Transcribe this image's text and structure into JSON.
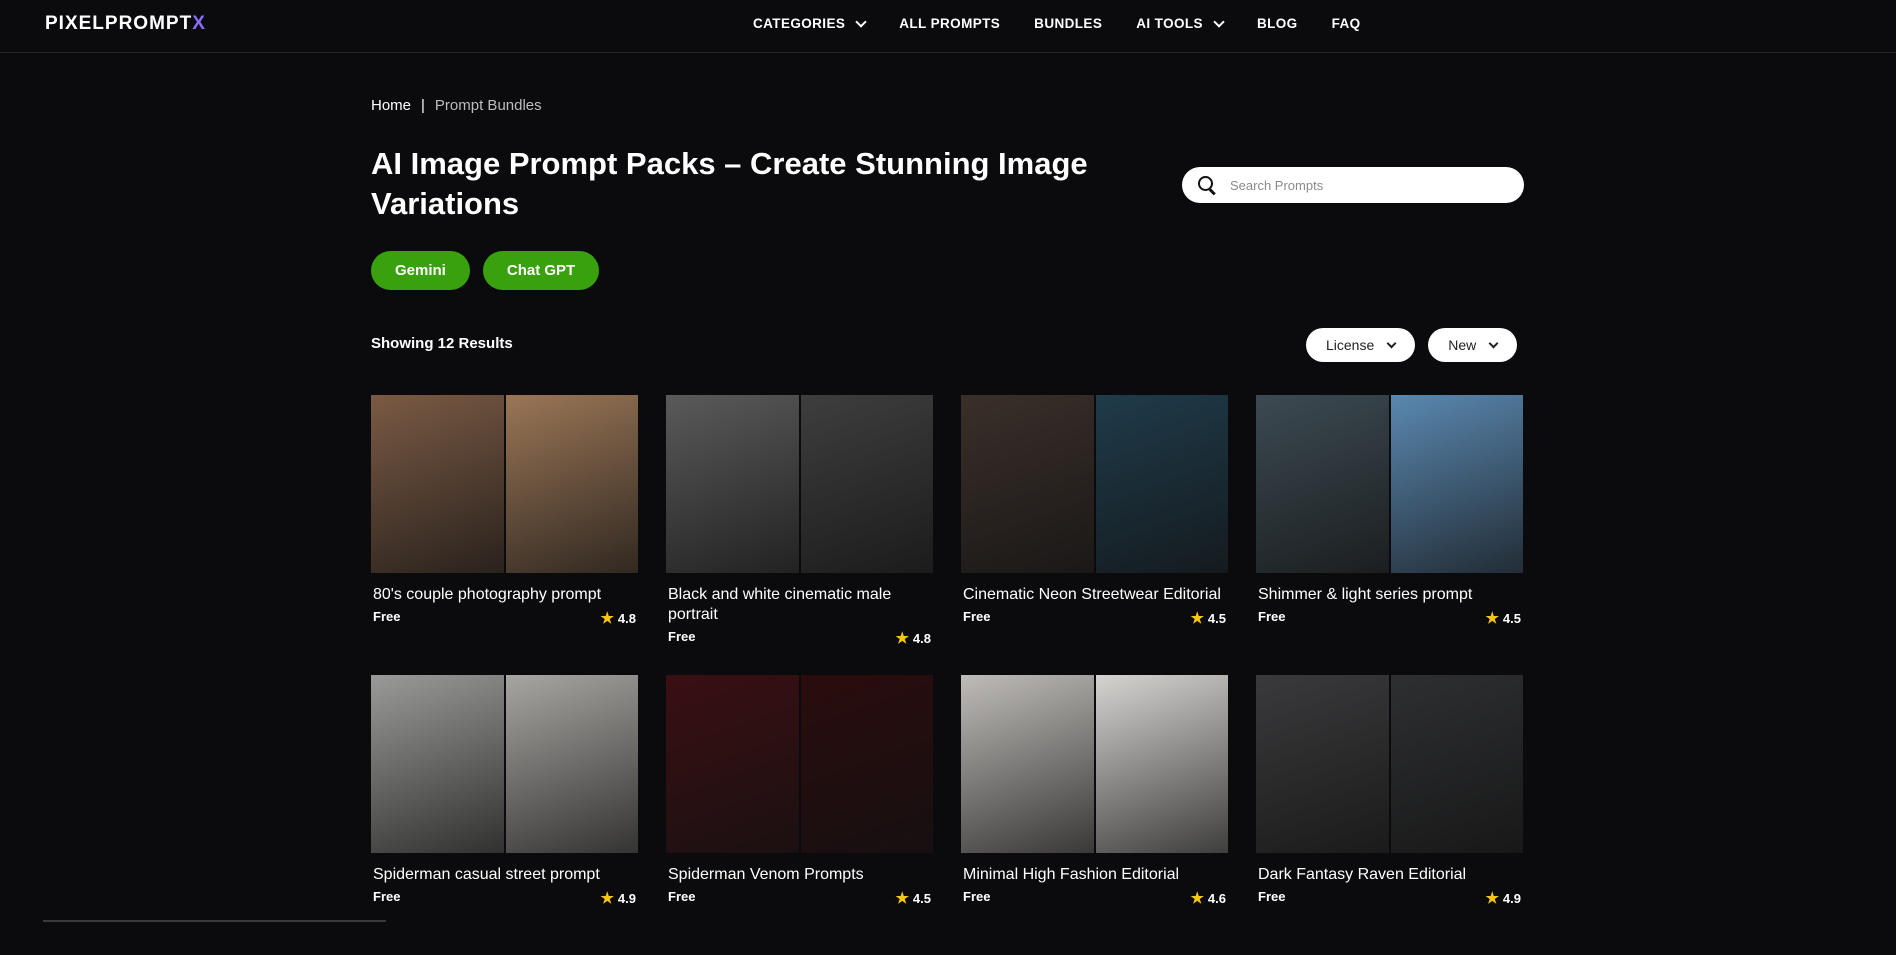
{
  "logo": {
    "main": "PIXELPROMPT",
    "accent": "X"
  },
  "nav": [
    {
      "label": "CATEGORIES",
      "dropdown": true
    },
    {
      "label": "ALL PROMPTS",
      "dropdown": false
    },
    {
      "label": "BUNDLES",
      "dropdown": false
    },
    {
      "label": "AI TOOLS",
      "dropdown": true
    },
    {
      "label": "BLOG",
      "dropdown": false
    },
    {
      "label": "FAQ",
      "dropdown": false
    }
  ],
  "breadcrumb": {
    "home": "Home",
    "separator": "|",
    "current": "Prompt Bundles"
  },
  "page_title": "AI Image Prompt Packs – Create Stunning Image Variations",
  "search": {
    "placeholder": "Search Prompts"
  },
  "pills": [
    "Gemini",
    "Chat GPT"
  ],
  "results_text": "Showing 12 Results",
  "filters": [
    "License",
    "New"
  ],
  "accent_colors": {
    "pill": "#3aa10e",
    "star": "#f5c518",
    "logo_x": "#8b6cff"
  },
  "cards": [
    {
      "name": "80's couple photography prompt",
      "license": "Free",
      "rating": "4.8",
      "colors": [
        "#7a5a44",
        "#9a7656"
      ]
    },
    {
      "name": "Black and white cinematic male portrait",
      "license": "Free",
      "rating": "4.8",
      "colors": [
        "#5a5a5a",
        "#3e3e3e"
      ]
    },
    {
      "name": "Cinematic Neon Streetwear Editorial",
      "license": "Free",
      "rating": "4.5",
      "colors": [
        "#3a2f2a",
        "#1f3b4a"
      ]
    },
    {
      "name": "Shimmer & light series prompt",
      "license": "Free",
      "rating": "4.5",
      "colors": [
        "#3c4a52",
        "#5a88b0"
      ]
    },
    {
      "name": "Spiderman casual street prompt",
      "license": "Free",
      "rating": "4.9",
      "colors": [
        "#9a9a98",
        "#a8a6a2"
      ]
    },
    {
      "name": "Spiderman Venom Prompts",
      "license": "Free",
      "rating": "4.5",
      "colors": [
        "#3a0f12",
        "#2a0c0e"
      ]
    },
    {
      "name": "Minimal High Fashion Editorial",
      "license": "Free",
      "rating": "4.6",
      "colors": [
        "#bfbcb8",
        "#d6d4d1"
      ]
    },
    {
      "name": "Dark Fantasy Raven Editorial",
      "license": "Free",
      "rating": "4.9",
      "colors": [
        "#3a3a3c",
        "#2e2f31"
      ]
    }
  ]
}
